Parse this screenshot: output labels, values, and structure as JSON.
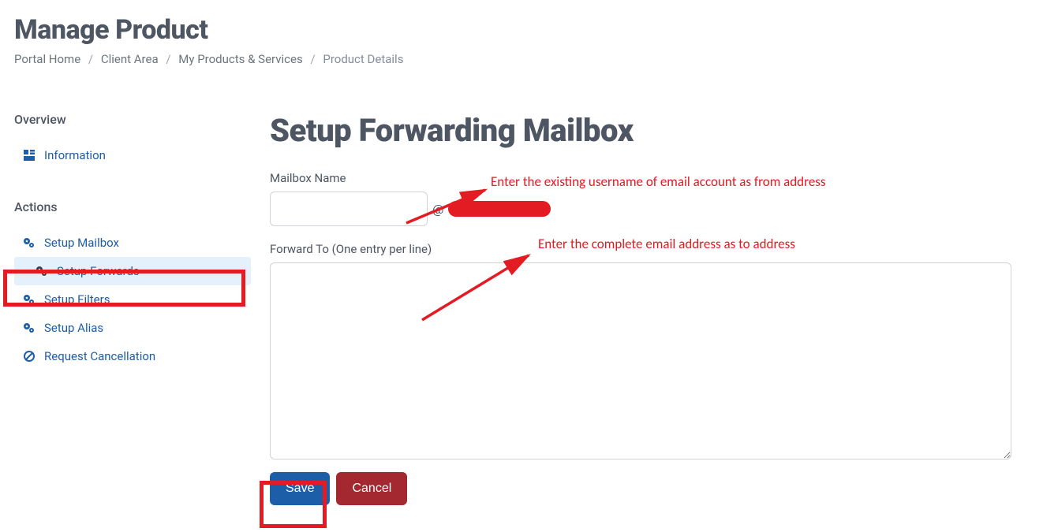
{
  "page_title": "Manage Product",
  "breadcrumb": {
    "items": [
      "Portal Home",
      "Client Area",
      "My Products & Services"
    ],
    "current": "Product Details"
  },
  "sidebar": {
    "overview_heading": "Overview",
    "overview_items": [
      {
        "label": "Information",
        "icon": "info-tiles-icon"
      }
    ],
    "actions_heading": "Actions",
    "actions_items": [
      {
        "label": "Setup Mailbox",
        "icon": "gears-icon",
        "active": false
      },
      {
        "label": "Setup Forwards",
        "icon": "gears-icon",
        "active": true
      },
      {
        "label": "Setup Filters",
        "icon": "gears-icon",
        "active": false
      },
      {
        "label": "Setup Alias",
        "icon": "gears-icon",
        "active": false
      },
      {
        "label": "Request Cancellation",
        "icon": "ban-icon",
        "active": false
      }
    ]
  },
  "main": {
    "title": "Setup Forwarding Mailbox",
    "mailbox_label": "Mailbox Name",
    "mailbox_value": "",
    "at": "@",
    "forward_label": "Forward To (One entry per line)",
    "forward_value": "",
    "save_label": "Save",
    "cancel_label": "Cancel"
  },
  "annotations": {
    "line1": "Enter the existing username of email account as from address",
    "line2": "Enter the complete email address as to address"
  }
}
